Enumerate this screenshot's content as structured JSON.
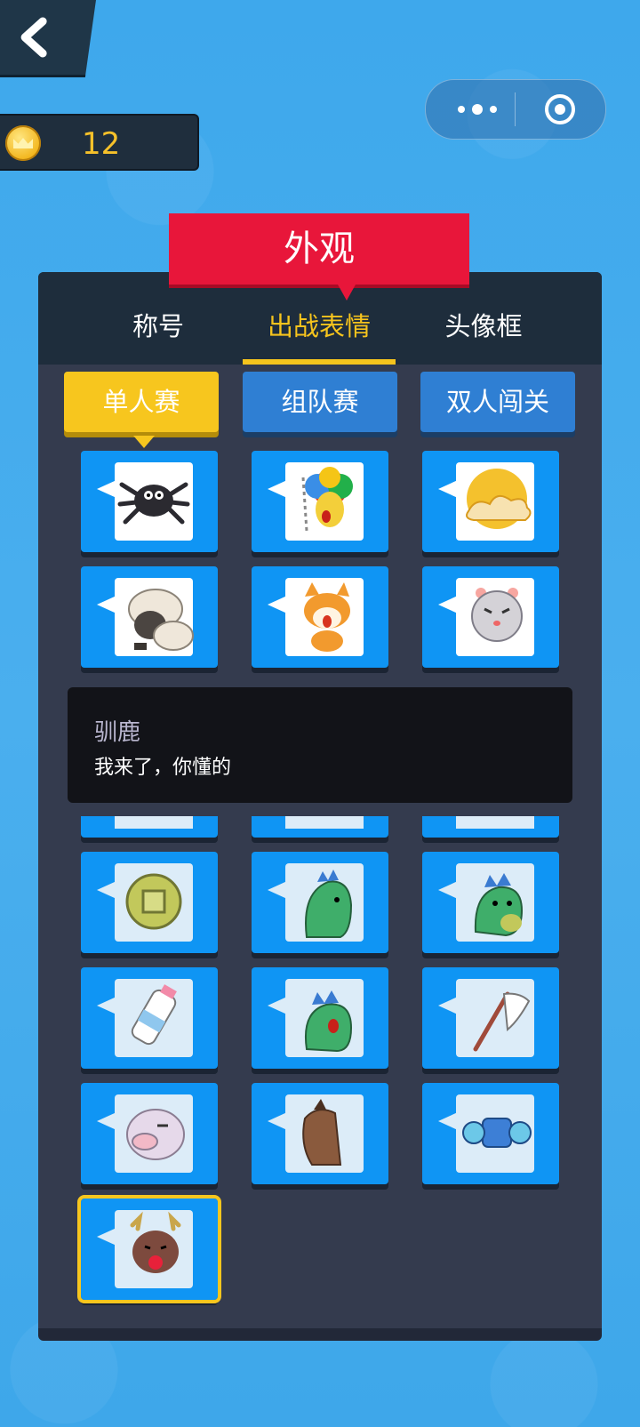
{
  "header": {
    "coins": "12",
    "icons": {
      "back": "chevron-left-icon",
      "coin": "crown-coin-icon",
      "more": "more-dots-icon",
      "close": "target-circle-icon"
    }
  },
  "title": "外观",
  "tabs": [
    {
      "label": "称号",
      "active": false
    },
    {
      "label": "出战表情",
      "active": true
    },
    {
      "label": "头像框",
      "active": false
    }
  ],
  "modes": [
    {
      "label": "单人赛",
      "active": true
    },
    {
      "label": "组队赛",
      "active": false
    },
    {
      "label": "双人闯关",
      "active": false
    }
  ],
  "emotes": [
    {
      "name": "spider-emote",
      "owned": true
    },
    {
      "name": "rainbow-hair-emote",
      "owned": true
    },
    {
      "name": "sun-cloud-emote",
      "owned": true
    },
    {
      "name": "sheep-emote",
      "owned": true
    },
    {
      "name": "shiba-emote",
      "owned": true
    },
    {
      "name": "hamster-emote",
      "owned": true
    },
    {
      "name": "coin-emote",
      "owned": false
    },
    {
      "name": "dino-knit-emote",
      "owned": false
    },
    {
      "name": "dino-cry-emote",
      "owned": false
    },
    {
      "name": "milk-bottle-emote",
      "owned": false
    },
    {
      "name": "dino-shout-emote",
      "owned": false
    },
    {
      "name": "white-flag-emote",
      "owned": false
    },
    {
      "name": "pig-emote",
      "owned": false
    },
    {
      "name": "horse-emote",
      "owned": false
    },
    {
      "name": "mask-emote",
      "owned": false
    },
    {
      "name": "reindeer-emote",
      "owned": false,
      "selected": true
    }
  ],
  "tooltip": {
    "name": "驯鹿",
    "description": "我来了，你懂的"
  },
  "colors": {
    "accent": "#f6c41d",
    "banner": "#e8163a",
    "panel": "#343b4e",
    "tile": "#0f95f4"
  }
}
